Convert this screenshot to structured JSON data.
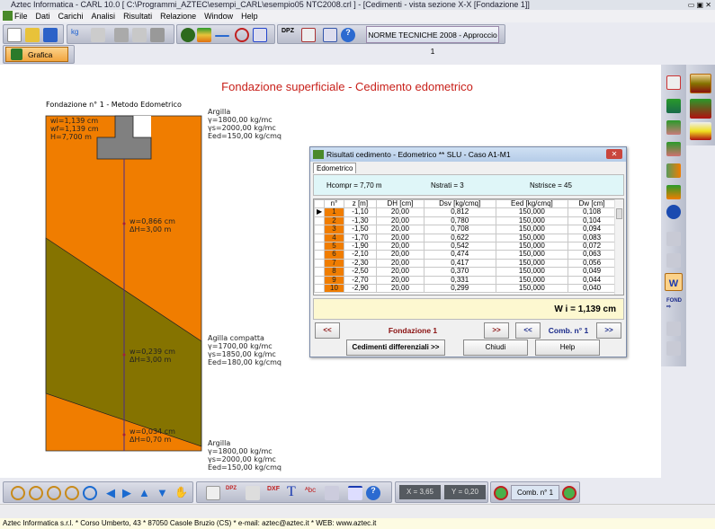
{
  "window": {
    "title": "Aztec Informatica - CARL 10.0 [ C:\\Programmi_AZTEC\\esempi_CARL\\esempio05 NTC2008.crl ] - [Cedimenti - vista sezione X-X [Fondazione 1]]"
  },
  "menu": [
    "File",
    "Dati",
    "Carichi",
    "Analisi",
    "Risultati",
    "Relazione",
    "Window",
    "Help"
  ],
  "toolbar": {
    "norme": "NORME TECNICHE 2008 - Approccio 1",
    "grafica": "Grafica"
  },
  "drawing": {
    "title": "Fondazione superficiale - Cedimento edometrico",
    "subtitle": "Fondazione n° 1 - Metodo Edometrico",
    "summary": [
      "wi=1,139 cm",
      "wf=1,139 cm",
      "H=7,700 m"
    ],
    "layer_labels": [
      {
        "name": "Argilla",
        "g": "γ=1800,00 kg/mc",
        "gs": "γs=2000,00 kg/mc",
        "eed": "Eed=150,00 kg/cmq"
      },
      {
        "name": "Agilla compatta",
        "g": "γ=1700,00 kg/mc",
        "gs": "γs=1850,00 kg/mc",
        "eed": "Eed=180,00 kg/cmq"
      },
      {
        "name": "Argilla",
        "g": "γ=1800,00 kg/mc",
        "gs": "γs=2000,00 kg/mc",
        "eed": "Eed=150,00 kg/cmq"
      }
    ],
    "layer_results": [
      {
        "w": "w=0,866 cm",
        "dh": "ΔH=3,00 m"
      },
      {
        "w": "w=0,239 cm",
        "dh": "ΔH=3,00 m"
      },
      {
        "w": "w=0,034 cm",
        "dh": "ΔH=0,70 m"
      }
    ],
    "colors": {
      "argilla": "#f07d00",
      "compatta": "#857300",
      "footing": "#808080"
    }
  },
  "dialog": {
    "title": "Risultati cedimento - Edometrico ** SLU - Caso A1-M1",
    "tab": "Edometrico",
    "hcompr": "Hcompr = 7,70 m",
    "nstrati": "Nstrati = 3",
    "nstrisce": "Nstrisce = 45",
    "columns": [
      "n°",
      "z [m]",
      "DH [cm]",
      "Dsv [kg/cmq]",
      "Eed [kg/cmq]",
      "Dw [cm]"
    ],
    "rows": [
      [
        "1",
        "-1,10",
        "20,00",
        "0,812",
        "150,000",
        "0,108"
      ],
      [
        "2",
        "-1,30",
        "20,00",
        "0,780",
        "150,000",
        "0,104"
      ],
      [
        "3",
        "-1,50",
        "20,00",
        "0,708",
        "150,000",
        "0,094"
      ],
      [
        "4",
        "-1,70",
        "20,00",
        "0,622",
        "150,000",
        "0,083"
      ],
      [
        "5",
        "-1,90",
        "20,00",
        "0,542",
        "150,000",
        "0,072"
      ],
      [
        "6",
        "-2,10",
        "20,00",
        "0,474",
        "150,000",
        "0,063"
      ],
      [
        "7",
        "-2,30",
        "20,00",
        "0,417",
        "150,000",
        "0,056"
      ],
      [
        "8",
        "-2,50",
        "20,00",
        "0,370",
        "150,000",
        "0,049"
      ],
      [
        "9",
        "-2,70",
        "20,00",
        "0,331",
        "150,000",
        "0,044"
      ],
      [
        "10",
        "-2,90",
        "20,00",
        "0,299",
        "150,000",
        "0,040"
      ]
    ],
    "total": "W i = 1,139 cm",
    "prev": "<<",
    "next": ">>",
    "fondazione": "Fondazione 1",
    "comb": "Comb. n° 1",
    "cedimenti": "Cedimenti differenziali >>",
    "chiudi": "Chiudi",
    "help": "Help"
  },
  "bottom": {
    "x": "X = 3,65",
    "y": "Y = 0,20",
    "comb": "Comb. n° 1"
  },
  "footer": "Aztec Informatica s.r.l. * Corso Umberto, 43 * 87050 Casole Bruzio (CS)  *  e-mail:  aztec@aztec.it  *  WEB: www.aztec.it"
}
